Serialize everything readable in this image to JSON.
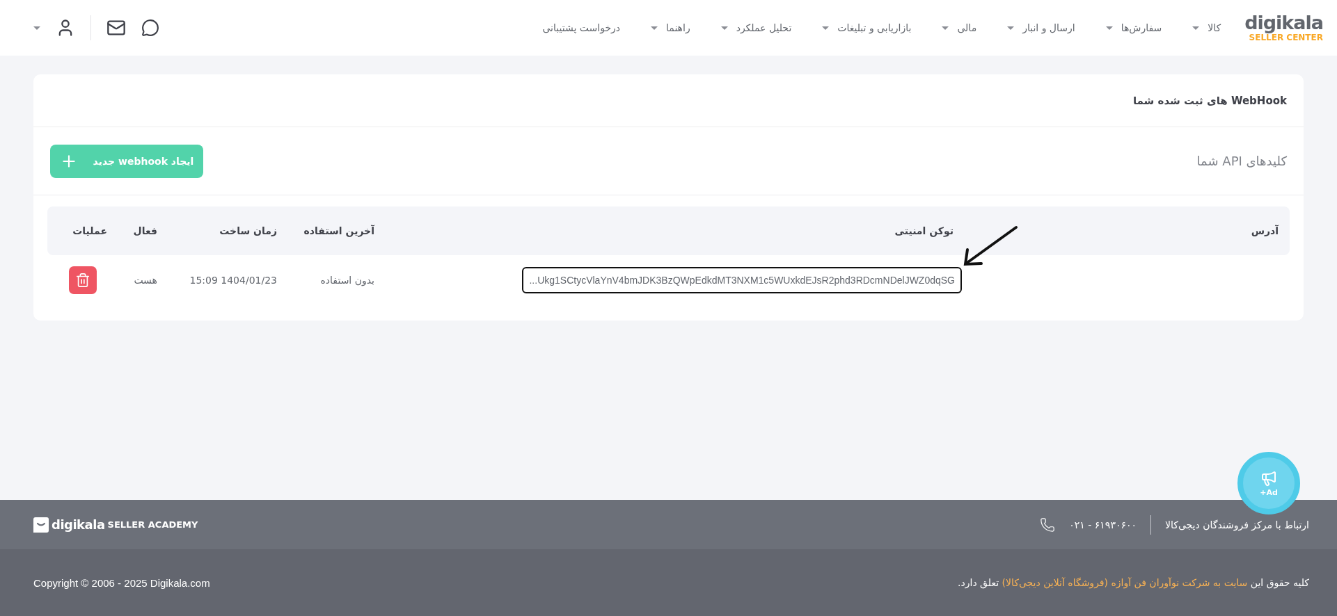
{
  "logo": {
    "name": "digikala",
    "subtitle": "SELLER CENTER"
  },
  "nav": [
    {
      "label": "کالا",
      "has_menu": true
    },
    {
      "label": "سفارش‌ها",
      "has_menu": true
    },
    {
      "label": "ارسال و انبار",
      "has_menu": true
    },
    {
      "label": "مالی",
      "has_menu": true
    },
    {
      "label": "بازاریابی و تبلیغات",
      "has_menu": true
    },
    {
      "label": "تحلیل عملکرد",
      "has_menu": true
    },
    {
      "label": "راهنما",
      "has_menu": true
    },
    {
      "label": "درخواست پشتیبانی",
      "has_menu": false
    }
  ],
  "card": {
    "title": "WebHook های ثبت شده شما",
    "section_title": "کلیدهای API شما",
    "create_button": "ایجاد webhook جدید"
  },
  "table": {
    "columns": [
      "آدرس",
      "توکن امنیتی",
      "آخرین استفاده",
      "زمان ساخت",
      "فعال",
      "عملیات"
    ],
    "rows": [
      {
        "token": "...Ukg1SCtycVlaYnV4bmJDK3BzQWpEdkdMT3NXM1c5WUxkdEJsR2phd3RDcmNDelJWZ0dqSG",
        "last_used": "بدون استفاده",
        "created": "15:09 1404/01/23",
        "active": "هست"
      }
    ]
  },
  "ad_button": "+Ad",
  "footer": {
    "contact": "ارتباط با مرکز فروشندگان دیجی‌کالا",
    "phone": "۰۲۱ - ۶۱۹۳۰۶۰۰",
    "academy": {
      "name": "digikala",
      "subtitle": "SELLER ACADEMY"
    },
    "copyright": {
      "before": "کلیه حقوق این",
      "link": "سایت به شرکت نوآوران فن آوازه (فروشگاه آنلاین دیجی‌کالا)",
      "after": "تعلق دارد."
    },
    "copyright_en": "Copyright © 2006 - 2025 Digikala.com"
  }
}
